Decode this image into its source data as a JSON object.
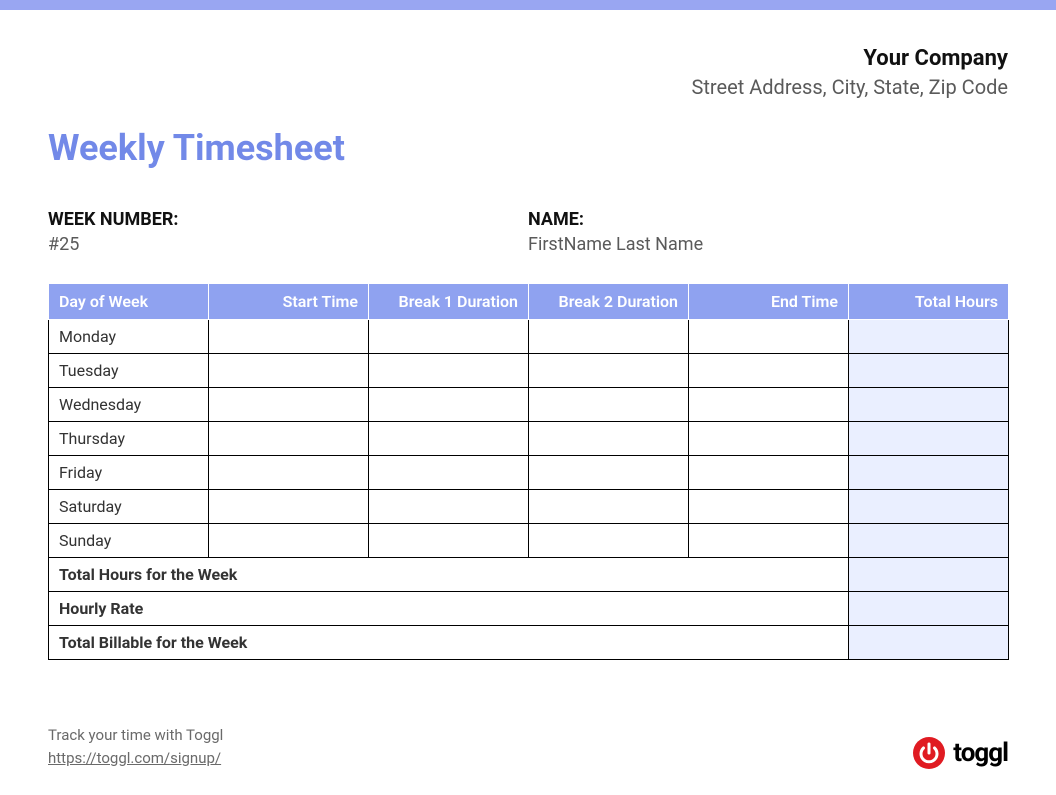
{
  "colors": {
    "topbar": "#99a6f2",
    "header_bg": "#8fa2f0",
    "title": "#7289e8",
    "total_col_bg": "#eaefff"
  },
  "company": {
    "name": "Your Company",
    "address": "Street Address, City, State, Zip Code"
  },
  "title": "Weekly Timesheet",
  "meta": {
    "week_label": "WEEK NUMBER:",
    "week_value": "#25",
    "name_label": "NAME:",
    "name_value": "FirstName Last Name"
  },
  "table": {
    "headers": {
      "day": "Day of Week",
      "start": "Start Time",
      "break1": "Break 1 Duration",
      "break2": "Break 2 Duration",
      "end": "End Time",
      "total": "Total Hours"
    },
    "rows": [
      {
        "day": "Monday",
        "start": "",
        "break1": "",
        "break2": "",
        "end": "",
        "total": ""
      },
      {
        "day": "Tuesday",
        "start": "",
        "break1": "",
        "break2": "",
        "end": "",
        "total": ""
      },
      {
        "day": "Wednesday",
        "start": "",
        "break1": "",
        "break2": "",
        "end": "",
        "total": ""
      },
      {
        "day": "Thursday",
        "start": "",
        "break1": "",
        "break2": "",
        "end": "",
        "total": ""
      },
      {
        "day": "Friday",
        "start": "",
        "break1": "",
        "break2": "",
        "end": "",
        "total": ""
      },
      {
        "day": "Saturday",
        "start": "",
        "break1": "",
        "break2": "",
        "end": "",
        "total": ""
      },
      {
        "day": "Sunday",
        "start": "",
        "break1": "",
        "break2": "",
        "end": "",
        "total": ""
      }
    ],
    "summary": {
      "total_hours_label": "Total Hours for the Week",
      "total_hours_value": "",
      "hourly_rate_label": "Hourly Rate",
      "hourly_rate_value": "",
      "total_billable_label": "Total Billable for the Week",
      "total_billable_value": ""
    }
  },
  "footer": {
    "tagline": "Track your time with Toggl",
    "link_text": "https://toggl.com/signup/",
    "logo_text": "toggl"
  }
}
